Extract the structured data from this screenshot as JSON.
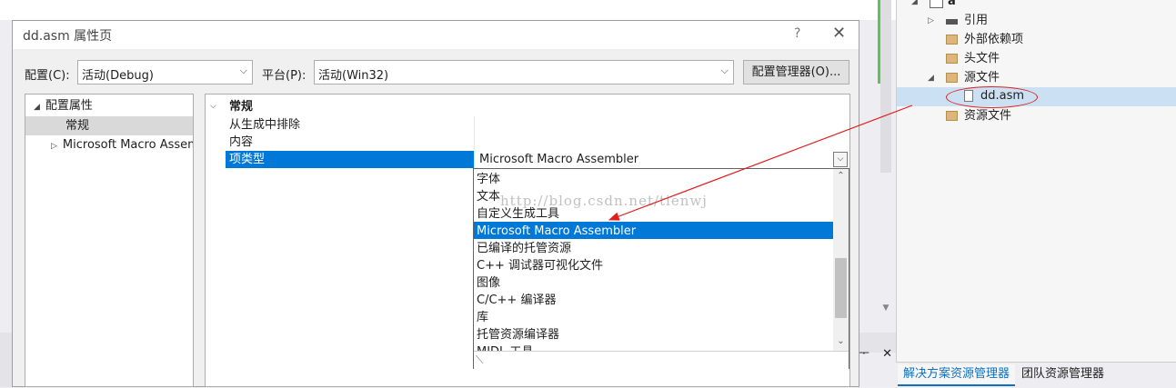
{
  "dialog": {
    "title": "dd.asm 属性页",
    "help_label": "?",
    "close_label": "✕",
    "config_label": "配置(C):",
    "config_value": "活动(Debug)",
    "platform_label": "平台(P):",
    "platform_value": "活动(Win32)",
    "config_manager_label": "配置管理器(O)..."
  },
  "left_tree": {
    "root_label": "配置属性",
    "general_label": "常规",
    "masm_label": "Microsoft Macro Assembler"
  },
  "grid": {
    "section_label": "常规",
    "rows": [
      "从生成中排除",
      "内容",
      "项类型"
    ],
    "selected_value": "Microsoft Macro Assembler"
  },
  "dropdown": {
    "items": [
      "字体",
      "文本",
      "自定义生成工具",
      "Microsoft Macro Assembler",
      "已编译的托管资源",
      "C++ 调试器可视化文件",
      "图像",
      "C/C++ 编译器",
      "库",
      "托管资源编译器",
      "MIDL 工具"
    ],
    "selected_index": 3
  },
  "watermark": "http://blog.csdn.net/tienwj",
  "solution_explorer": {
    "project": "a",
    "items": [
      "引用",
      "外部依赖项",
      "头文件",
      "源文件",
      "dd.asm",
      "资源文件"
    ],
    "tabs": [
      "解决方案资源管理器",
      "团队资源管理器"
    ]
  },
  "output_panel": {
    "pin": "ᅮ",
    "close": "✕"
  },
  "colors": {
    "accent": "#0078d7",
    "annotation": "#e02020",
    "highlight": "#cce0f4"
  }
}
